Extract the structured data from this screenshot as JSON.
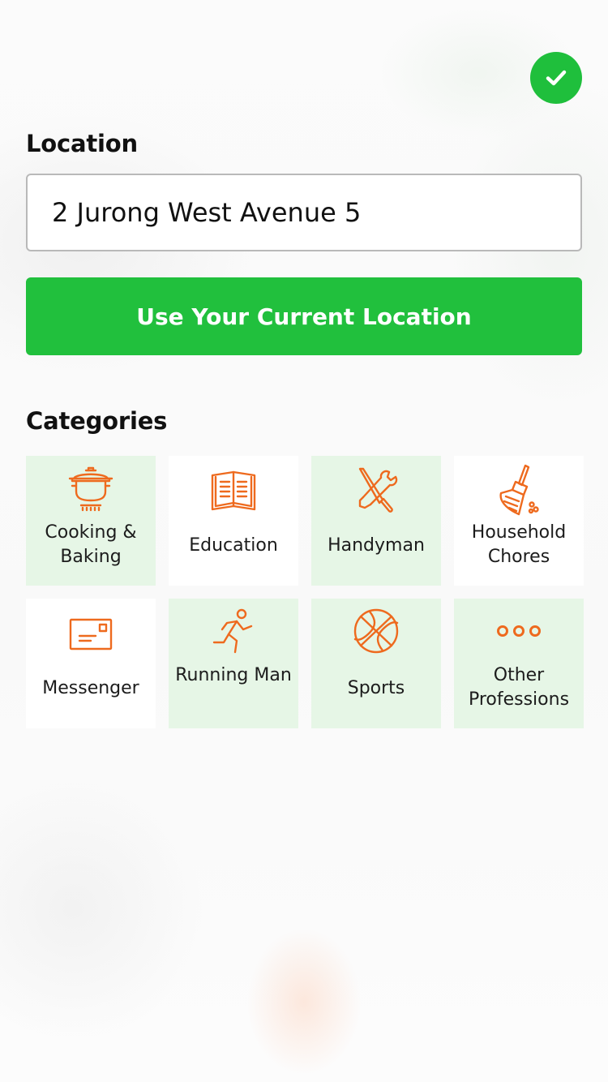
{
  "header": {
    "confirm_icon": "checkmark-icon"
  },
  "location": {
    "label": "Location",
    "value": "2 Jurong West Avenue 5",
    "use_current_label": "Use Your Current Location"
  },
  "categories": {
    "label": "Categories",
    "items": [
      {
        "label": "Cooking & Baking",
        "icon": "cooking-pot-icon",
        "highlighted": true
      },
      {
        "label": "Education",
        "icon": "open-book-icon",
        "highlighted": false
      },
      {
        "label": "Handyman",
        "icon": "tools-icon",
        "highlighted": true
      },
      {
        "label": "Household Chores",
        "icon": "broom-icon",
        "highlighted": false
      },
      {
        "label": "Messenger",
        "icon": "envelope-icon",
        "highlighted": false
      },
      {
        "label": "Running Man",
        "icon": "runner-icon",
        "highlighted": true
      },
      {
        "label": "Sports",
        "icon": "basketball-icon",
        "highlighted": true
      },
      {
        "label": "Other Professions",
        "icon": "more-dots-icon",
        "highlighted": true
      }
    ]
  },
  "colors": {
    "accent_green": "#21c03d",
    "icon_orange": "#ee6a1e",
    "tile_highlight": "#e6f6e6"
  }
}
